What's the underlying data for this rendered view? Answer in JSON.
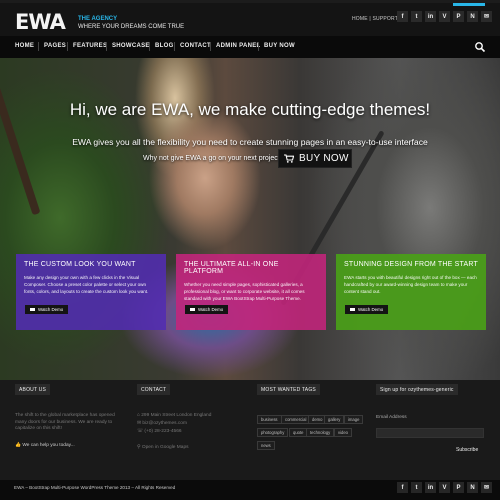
{
  "header": {
    "logo": "EWA",
    "tagline_1": "THE AGENCY",
    "tagline_2": "WHERE YOUR DREAMS COME TRUE",
    "home_link": "HOME",
    "support_link": "SUPPORT",
    "social": [
      "f",
      "t",
      "in",
      "V",
      "P",
      "N",
      "✉"
    ]
  },
  "nav": {
    "items": [
      "HOME",
      "PAGES",
      "FEATURES",
      "SHOWCASE",
      "BLOG",
      "CONTACT",
      "ADMIN PANEL",
      "BUY NOW"
    ]
  },
  "hero": {
    "title": "Hi, we are EWA, we make cutting-edge themes!",
    "subtitle": "EWA gives you all the flexibility you need to create stunning pages in an easy-to-use interface",
    "cta_text": "Why not give EWA a go on your next project?",
    "buy_label": "BUY NOW"
  },
  "features": [
    {
      "title": "THE CUSTOM LOOK YOU WANT",
      "text": "Make any design your own with a few clicks in the Visual Composer. Choose a preset color palette or select your own fonts, colors, and layouts to create the custom look you want.",
      "button": "Watch Demo"
    },
    {
      "title": "THE ULTIMATE ALL-IN ONE PLATFORM",
      "text": "Whether you need simple pages, sophisticated galleries, a professional blog, or want to corporate website, it all comes standard with your EWA BootStrap Multi-Purpose Theme.",
      "button": "Watch Demo"
    },
    {
      "title": "STUNNING DESIGN FROM THE START",
      "text": "EWA starts you with beautiful designs right out of the box — each handcrafted by our award-winning design team to make your content stand out.",
      "button": "Watch Demo"
    }
  ],
  "footer": {
    "about": {
      "heading": "ABOUT US",
      "text": "The shift to the global marketplace has opened many doors for our business. We are ready to capitalize on this shift!",
      "help": "We can help you today..."
    },
    "contact": {
      "heading": "CONTACT",
      "address": "299 Main Street London England",
      "email": "biz@ozythemes.com",
      "phone": "(+0) 28-223-4566",
      "map_link": "Open in Google Maps"
    },
    "tags": {
      "heading": "MOST WANTED TAGS",
      "items": [
        "business",
        "commercial",
        "demo",
        "gallery",
        "image",
        "photography",
        "quote",
        "technology",
        "video",
        "news"
      ]
    },
    "signup": {
      "heading": "Sign up for ozythemes-generic",
      "email_label": "Email Address",
      "subscribe": "Subscribe"
    }
  },
  "bottom": {
    "copyright": "EWA – BootStrap Multi-Purpose WordPress Theme 2013 – All Rights Reserved",
    "social": [
      "f",
      "t",
      "in",
      "V",
      "P",
      "N",
      "✉"
    ]
  },
  "colors": {
    "accent": "#29b6e8",
    "feature_purple": "#522cb2",
    "feature_magenta": "#c4247c",
    "feature_green": "#4aa018"
  }
}
